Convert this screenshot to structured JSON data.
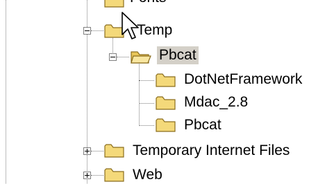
{
  "tree": {
    "partial_top_label": "Fonts",
    "items": [
      {
        "label": "Temp",
        "expanded": true,
        "selected": false
      },
      {
        "label": "Pbcat",
        "expanded": true,
        "selected": true
      },
      {
        "label": "DotNetFramework",
        "expanded": false,
        "selected": false
      },
      {
        "label": "Mdac_2.8",
        "expanded": false,
        "selected": false
      },
      {
        "label": "Pbcat",
        "expanded": false,
        "selected": false
      },
      {
        "label": "Temporary Internet Files",
        "expanded": false,
        "selected": false
      },
      {
        "label": "Web",
        "expanded": false,
        "selected": false
      }
    ]
  },
  "colors": {
    "folder_fill": "#f4d97a",
    "folder_outline": "#8a6d1e",
    "selection": "#d4d0c8",
    "guide_line": "#7a7a7a"
  },
  "cursor": {
    "icon": "arrow-pointer-icon"
  }
}
